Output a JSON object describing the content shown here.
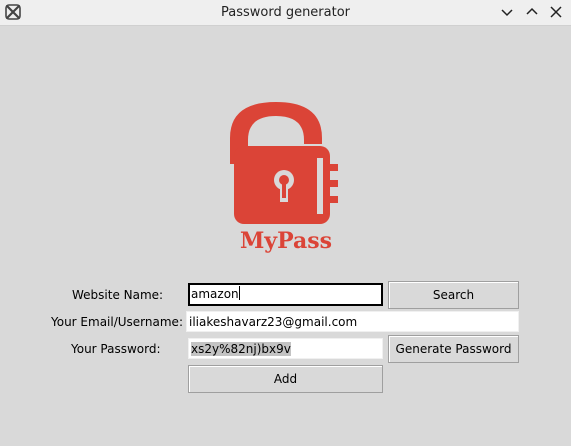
{
  "window": {
    "title": "Password generator"
  },
  "logo": {
    "text": "MyPass",
    "color": "#db4437"
  },
  "form": {
    "website_label": "Website Name:",
    "website_value": "amazon",
    "search_label": "Search",
    "email_label": "Your Email/Username:",
    "email_value": "iliakeshavarz23@gmail.com",
    "password_label": "Your Password:",
    "password_value": "xs2y%82nj)bx9v",
    "generate_label": "Generate Password",
    "add_label": "Add"
  }
}
